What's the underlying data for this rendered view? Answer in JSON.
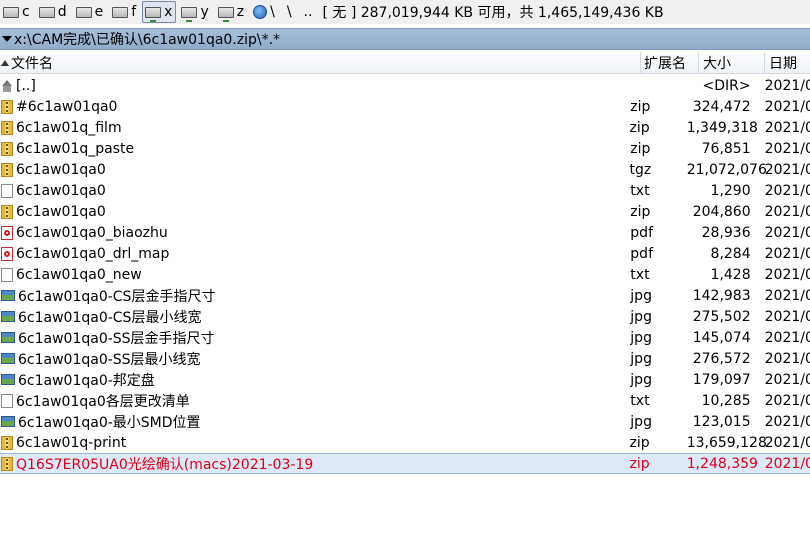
{
  "drivebar": {
    "drives": [
      {
        "letter": "c",
        "active": false,
        "type": "local"
      },
      {
        "letter": "d",
        "active": false,
        "type": "local"
      },
      {
        "letter": "e",
        "active": false,
        "type": "local"
      },
      {
        "letter": "f",
        "active": false,
        "type": "local"
      },
      {
        "letter": "x",
        "active": true,
        "type": "network"
      },
      {
        "letter": "y",
        "active": false,
        "type": "network"
      },
      {
        "letter": "z",
        "active": false,
        "type": "network"
      },
      {
        "letter": "\\",
        "active": false,
        "type": "globe"
      }
    ],
    "root_symbol": "\\",
    "parent_symbol": "..",
    "free_space": "[ 无 ]  287,019,944 KB 可用，共 1,465,149,436 KB"
  },
  "path": "x:\\CAM完成\\已确认\\6c1aw01qa0.zip\\*.*",
  "columns": {
    "name": "文件名",
    "ext": "扩展名",
    "size": "大小",
    "date": "日期"
  },
  "files": [
    {
      "name": "[..]",
      "ext": "",
      "size": "<DIR>",
      "date": "2021/0",
      "icon": "up",
      "selected": false
    },
    {
      "name": "#6c1aw01qa0",
      "ext": "zip",
      "size": "324,472",
      "date": "2021/0",
      "icon": "zip",
      "selected": false
    },
    {
      "name": "6c1aw01q_film",
      "ext": "zip",
      "size": "1,349,318",
      "date": "2021/0",
      "icon": "zip",
      "selected": false
    },
    {
      "name": "6c1aw01q_paste",
      "ext": "zip",
      "size": "76,851",
      "date": "2021/0",
      "icon": "zip",
      "selected": false
    },
    {
      "name": "6c1aw01qa0",
      "ext": "tgz",
      "size": "21,072,076",
      "date": "2021/0",
      "icon": "zip",
      "selected": false
    },
    {
      "name": "6c1aw01qa0",
      "ext": "txt",
      "size": "1,290",
      "date": "2021/0",
      "icon": "txt",
      "selected": false
    },
    {
      "name": "6c1aw01qa0",
      "ext": "zip",
      "size": "204,860",
      "date": "2021/0",
      "icon": "zip",
      "selected": false
    },
    {
      "name": "6c1aw01qa0_biaozhu",
      "ext": "pdf",
      "size": "28,936",
      "date": "2021/0",
      "icon": "pdf",
      "selected": false
    },
    {
      "name": "6c1aw01qa0_drl_map",
      "ext": "pdf",
      "size": "8,284",
      "date": "2021/0",
      "icon": "pdf",
      "selected": false
    },
    {
      "name": "6c1aw01qa0_new",
      "ext": "txt",
      "size": "1,428",
      "date": "2021/0",
      "icon": "txt",
      "selected": false
    },
    {
      "name": "6c1aw01qa0-CS层金手指尺寸",
      "ext": "jpg",
      "size": "142,983",
      "date": "2021/0",
      "icon": "jpg",
      "selected": false
    },
    {
      "name": "6c1aw01qa0-CS层最小线宽",
      "ext": "jpg",
      "size": "275,502",
      "date": "2021/0",
      "icon": "jpg",
      "selected": false
    },
    {
      "name": "6c1aw01qa0-SS层金手指尺寸",
      "ext": "jpg",
      "size": "145,074",
      "date": "2021/0",
      "icon": "jpg",
      "selected": false
    },
    {
      "name": "6c1aw01qa0-SS层最小线宽",
      "ext": "jpg",
      "size": "276,572",
      "date": "2021/0",
      "icon": "jpg",
      "selected": false
    },
    {
      "name": "6c1aw01qa0-邦定盘",
      "ext": "jpg",
      "size": "179,097",
      "date": "2021/0",
      "icon": "jpg",
      "selected": false
    },
    {
      "name": "6c1aw01qa0各层更改清单",
      "ext": "txt",
      "size": "10,285",
      "date": "2021/0",
      "icon": "txt",
      "selected": false
    },
    {
      "name": "6c1aw01qa0-最小SMD位置",
      "ext": "jpg",
      "size": "123,015",
      "date": "2021/0",
      "icon": "jpg",
      "selected": false
    },
    {
      "name": "6c1aw01q-print",
      "ext": "zip",
      "size": "13,659,128",
      "date": "2021/0",
      "icon": "zip",
      "selected": false
    },
    {
      "name": "Q16S7ER05UA0光绘确认(macs)2021-03-19",
      "ext": "zip",
      "size": "1,248,359",
      "date": "2021/0",
      "icon": "zip",
      "selected": true
    }
  ]
}
